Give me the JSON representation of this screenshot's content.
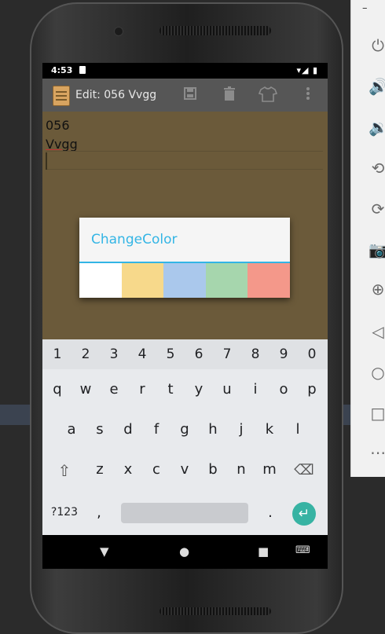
{
  "status_bar": {
    "time": "4:53",
    "icons": "▾◢ ▮"
  },
  "app_bar": {
    "title": "Edit: 056 Vvgg",
    "save_icon": "save-icon",
    "delete_icon": "trash-icon",
    "color_icon": "shirt-icon",
    "overflow_icon": "more-vert-icon"
  },
  "note": {
    "line1": "056",
    "line2": "Vvgg"
  },
  "dialog": {
    "title": "ChangeColor",
    "swatches": [
      {
        "name": "white",
        "color": "#ffffff"
      },
      {
        "name": "yellow",
        "color": "#f7d98b"
      },
      {
        "name": "blue",
        "color": "#aac8ec"
      },
      {
        "name": "green",
        "color": "#a6d6ad"
      },
      {
        "name": "red",
        "color": "#f4988a"
      }
    ]
  },
  "keyboard": {
    "numbers": [
      "1",
      "2",
      "3",
      "4",
      "5",
      "6",
      "7",
      "8",
      "9",
      "0"
    ],
    "row1": [
      "q",
      "w",
      "e",
      "r",
      "t",
      "y",
      "u",
      "i",
      "o",
      "p"
    ],
    "row2": [
      "a",
      "s",
      "d",
      "f",
      "g",
      "h",
      "j",
      "k",
      "l"
    ],
    "row3": [
      "z",
      "x",
      "c",
      "v",
      "b",
      "n",
      "m"
    ],
    "shift": "⇧",
    "backspace": "⌫",
    "symbols": "?123",
    "comma": ",",
    "period": ".",
    "enter": "↵"
  },
  "navbar": {
    "back": "▼",
    "home": "●",
    "recents": "■",
    "ime": "⌨"
  },
  "emulator_panel": {
    "minimize": "–",
    "icons": [
      "⏻",
      "🔊",
      "🔉",
      "⟲",
      "⟳",
      "📷",
      "⊕",
      "◁",
      "○",
      "□",
      "⋯"
    ]
  }
}
